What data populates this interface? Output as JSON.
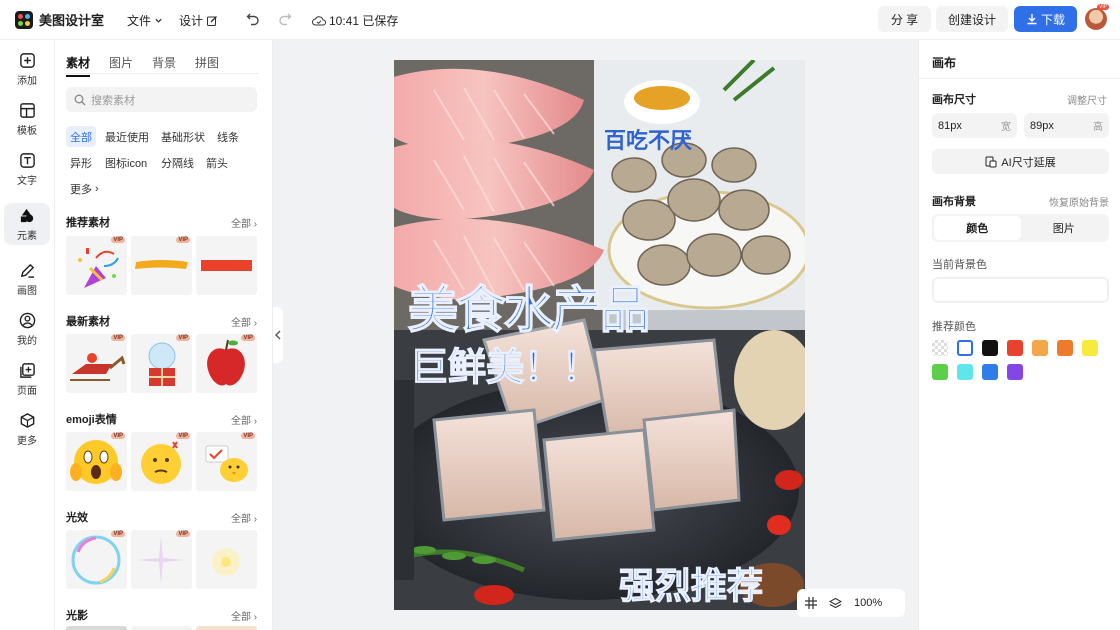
{
  "app": {
    "name": "美图设计室"
  },
  "topbar": {
    "file_menu": "文件",
    "design_menu": "设计",
    "save_status": "10:41 已保存",
    "share_label": "分 享",
    "create_label": "创建设计",
    "download_label": "下载",
    "avatar_badge": "VIP"
  },
  "rail": {
    "items": [
      {
        "label": "添加",
        "icon": "plus-square-icon"
      },
      {
        "label": "模板",
        "icon": "template-icon"
      },
      {
        "label": "文字",
        "icon": "text-icon"
      },
      {
        "label": "元素",
        "icon": "shapes-icon"
      },
      {
        "label": "画图",
        "icon": "pen-icon"
      },
      {
        "label": "我的",
        "icon": "user-icon"
      },
      {
        "label": "页面",
        "icon": "page-add-icon"
      },
      {
        "label": "更多",
        "icon": "cube-icon"
      }
    ]
  },
  "panel": {
    "tabs": [
      "素材",
      "图片",
      "背景",
      "拼图"
    ],
    "search_placeholder": "搜索素材",
    "chips": [
      "全部",
      "最近使用",
      "基础形状",
      "线条",
      "异形",
      "图标icon",
      "分隔线",
      "箭头",
      "更多"
    ],
    "all_label": "全部",
    "vip": "VIP",
    "sections": [
      {
        "title": "推荐素材"
      },
      {
        "title": "最新素材"
      },
      {
        "title": "emoji表情"
      },
      {
        "title": "光效"
      },
      {
        "title": "光影"
      }
    ]
  },
  "poster": {
    "tagline": "百吃不厌",
    "headline1": "美食水产品",
    "headline2": "巨鲜美！！",
    "bottom": "强烈推荐"
  },
  "zoom": {
    "level": "100%"
  },
  "right": {
    "title": "画布",
    "size_label": "画布尺寸",
    "adjust_label": "调整尺寸",
    "width_value": "81px",
    "width_unit": "宽",
    "height_value": "89px",
    "height_unit": "高",
    "ai_extend": "AI尺寸延展",
    "bg_label": "画布背景",
    "restore_label": "恢复原始背景",
    "seg_color": "颜色",
    "seg_image": "图片",
    "current_bg": "当前背景色",
    "recommend": "推荐颜色",
    "swatches": [
      "#ffffff",
      "#111111",
      "#e8412c",
      "#f4a64a",
      "#ee7b2c",
      "#f7ea3e",
      "#5bcf4a",
      "#5ee6ea",
      "#2f7de8",
      "#8446e6"
    ]
  }
}
